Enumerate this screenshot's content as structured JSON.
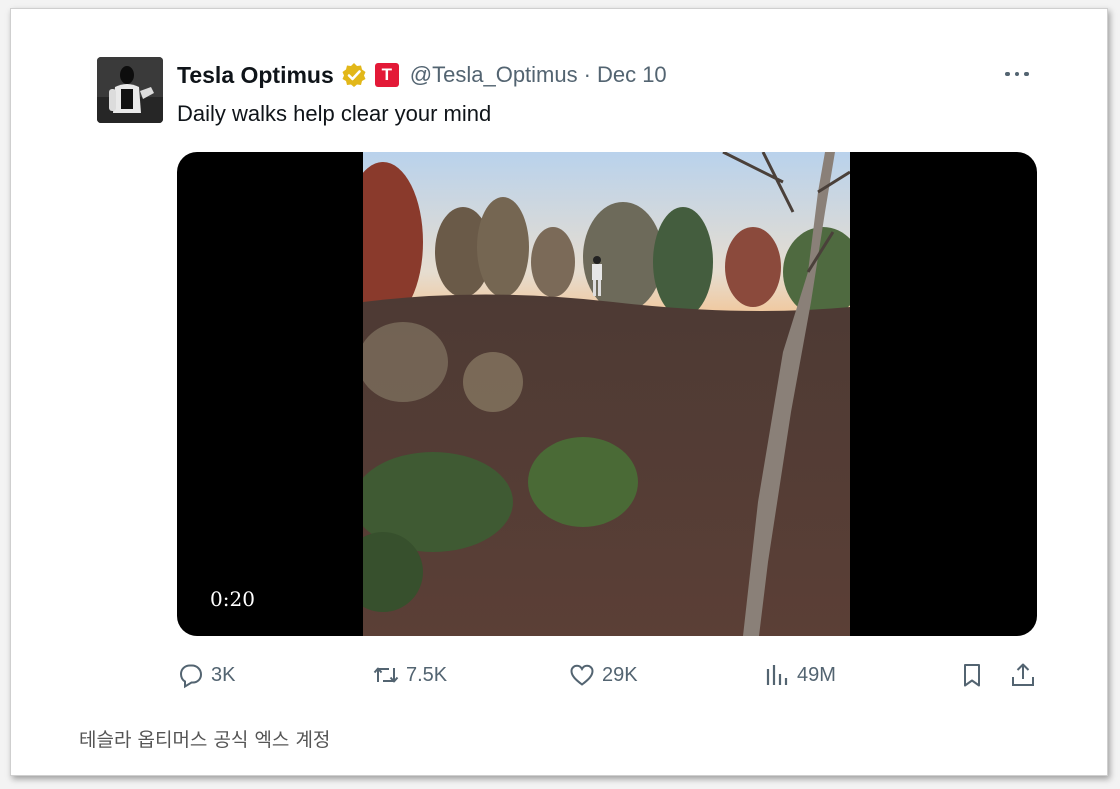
{
  "author": {
    "name": "Tesla Optimus",
    "handle": "@Tesla_Optimus",
    "separator": "·",
    "date": "Dec 10",
    "affiliate_badge": "T"
  },
  "tweet": {
    "text": "Daily walks help clear your mind"
  },
  "media": {
    "duration": "0:20"
  },
  "actions": {
    "replies": "3K",
    "reposts": "7.5K",
    "likes": "29K",
    "views": "49M"
  },
  "icons": {
    "more": "more-horizontal-icon",
    "reply": "speech-bubble-icon",
    "repost": "repost-arrows-icon",
    "like": "heart-icon",
    "views": "bar-chart-icon",
    "bookmark": "bookmark-icon",
    "share": "share-upload-icon",
    "verified": "gold-verified-badge-icon"
  },
  "colors": {
    "text": "#0f1419",
    "muted": "#536471",
    "verified_gold": "#e2b719",
    "tesla_red": "#e31937"
  },
  "caption": "테슬라 옵티머스 공식 엑스 계정"
}
